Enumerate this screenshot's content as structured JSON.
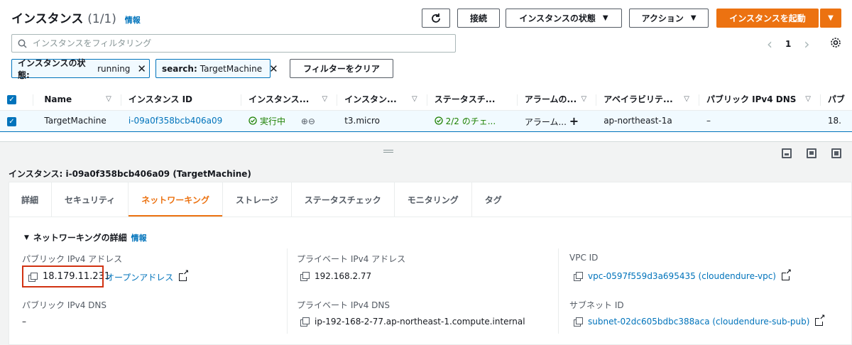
{
  "header": {
    "title": "インスタンス",
    "count": "(1/1)",
    "info": "情報"
  },
  "toolbar": {
    "refresh_icon": "refresh-icon",
    "connect": "接続",
    "instance_state": "インスタンスの状態",
    "actions": "アクション",
    "launch": "インスタンスを起動"
  },
  "search": {
    "placeholder": "インスタンスをフィルタリング"
  },
  "filters": {
    "tokens": [
      {
        "key": "インスタンスの状態:",
        "value": "running"
      },
      {
        "key": "search:",
        "value": "TargetMachine"
      }
    ],
    "clear": "フィルターをクリア"
  },
  "pagination": {
    "page": "1",
    "prev": "‹",
    "next": "›"
  },
  "table": {
    "columns": [
      "Name",
      "インスタンス ID",
      "インスタンス...",
      "インスタン...",
      "ステータスチ...",
      "アラームの...",
      "アベイラビリテ...",
      "パブリック IPv4 DNS",
      "パブ"
    ],
    "row": {
      "name": "TargetMachine",
      "instance_id": "i-09a0f358bcb406a09",
      "state": "実行中",
      "type": "t3.micro",
      "status_check": "2/2 のチェ...",
      "alarm": "アラーム...",
      "az": "ap-northeast-1a",
      "public_dns": "–",
      "public_ip_partial": "18."
    }
  },
  "detail": {
    "title": "インスタンス: i-09a0f358bcb406a09 (TargetMachine)",
    "tabs": [
      "詳細",
      "セキュリティ",
      "ネットワーキング",
      "ストレージ",
      "ステータスチェック",
      "モニタリング",
      "タグ"
    ],
    "active_tab": "ネットワーキング",
    "section": {
      "title": "ネットワーキングの詳細",
      "info": "情報"
    },
    "fields": {
      "public_ipv4_label": "パブリック IPv4 アドレス",
      "public_ipv4": "18.179.11.231",
      "open_address": "オープンアドレス",
      "private_ipv4_label": "プライベート IPv4 アドレス",
      "private_ipv4": "192.168.2.77",
      "vpc_label": "VPC ID",
      "vpc": "vpc-0597f559d3a695435 (cloudendure-vpc)",
      "public_dns_label": "パブリック IPv4 DNS",
      "public_dns": "–",
      "private_dns_label": "プライベート IPv4 DNS",
      "private_dns": "ip-192-168-2-77.ap-northeast-1.compute.internal",
      "subnet_label": "サブネット ID",
      "subnet": "subnet-02dc605bdbc388aca (cloudendure-sub-pub)"
    }
  },
  "colors": {
    "accent": "#ec7211",
    "link": "#0073bb",
    "success": "#1d8102",
    "highlight": "#d13212"
  }
}
